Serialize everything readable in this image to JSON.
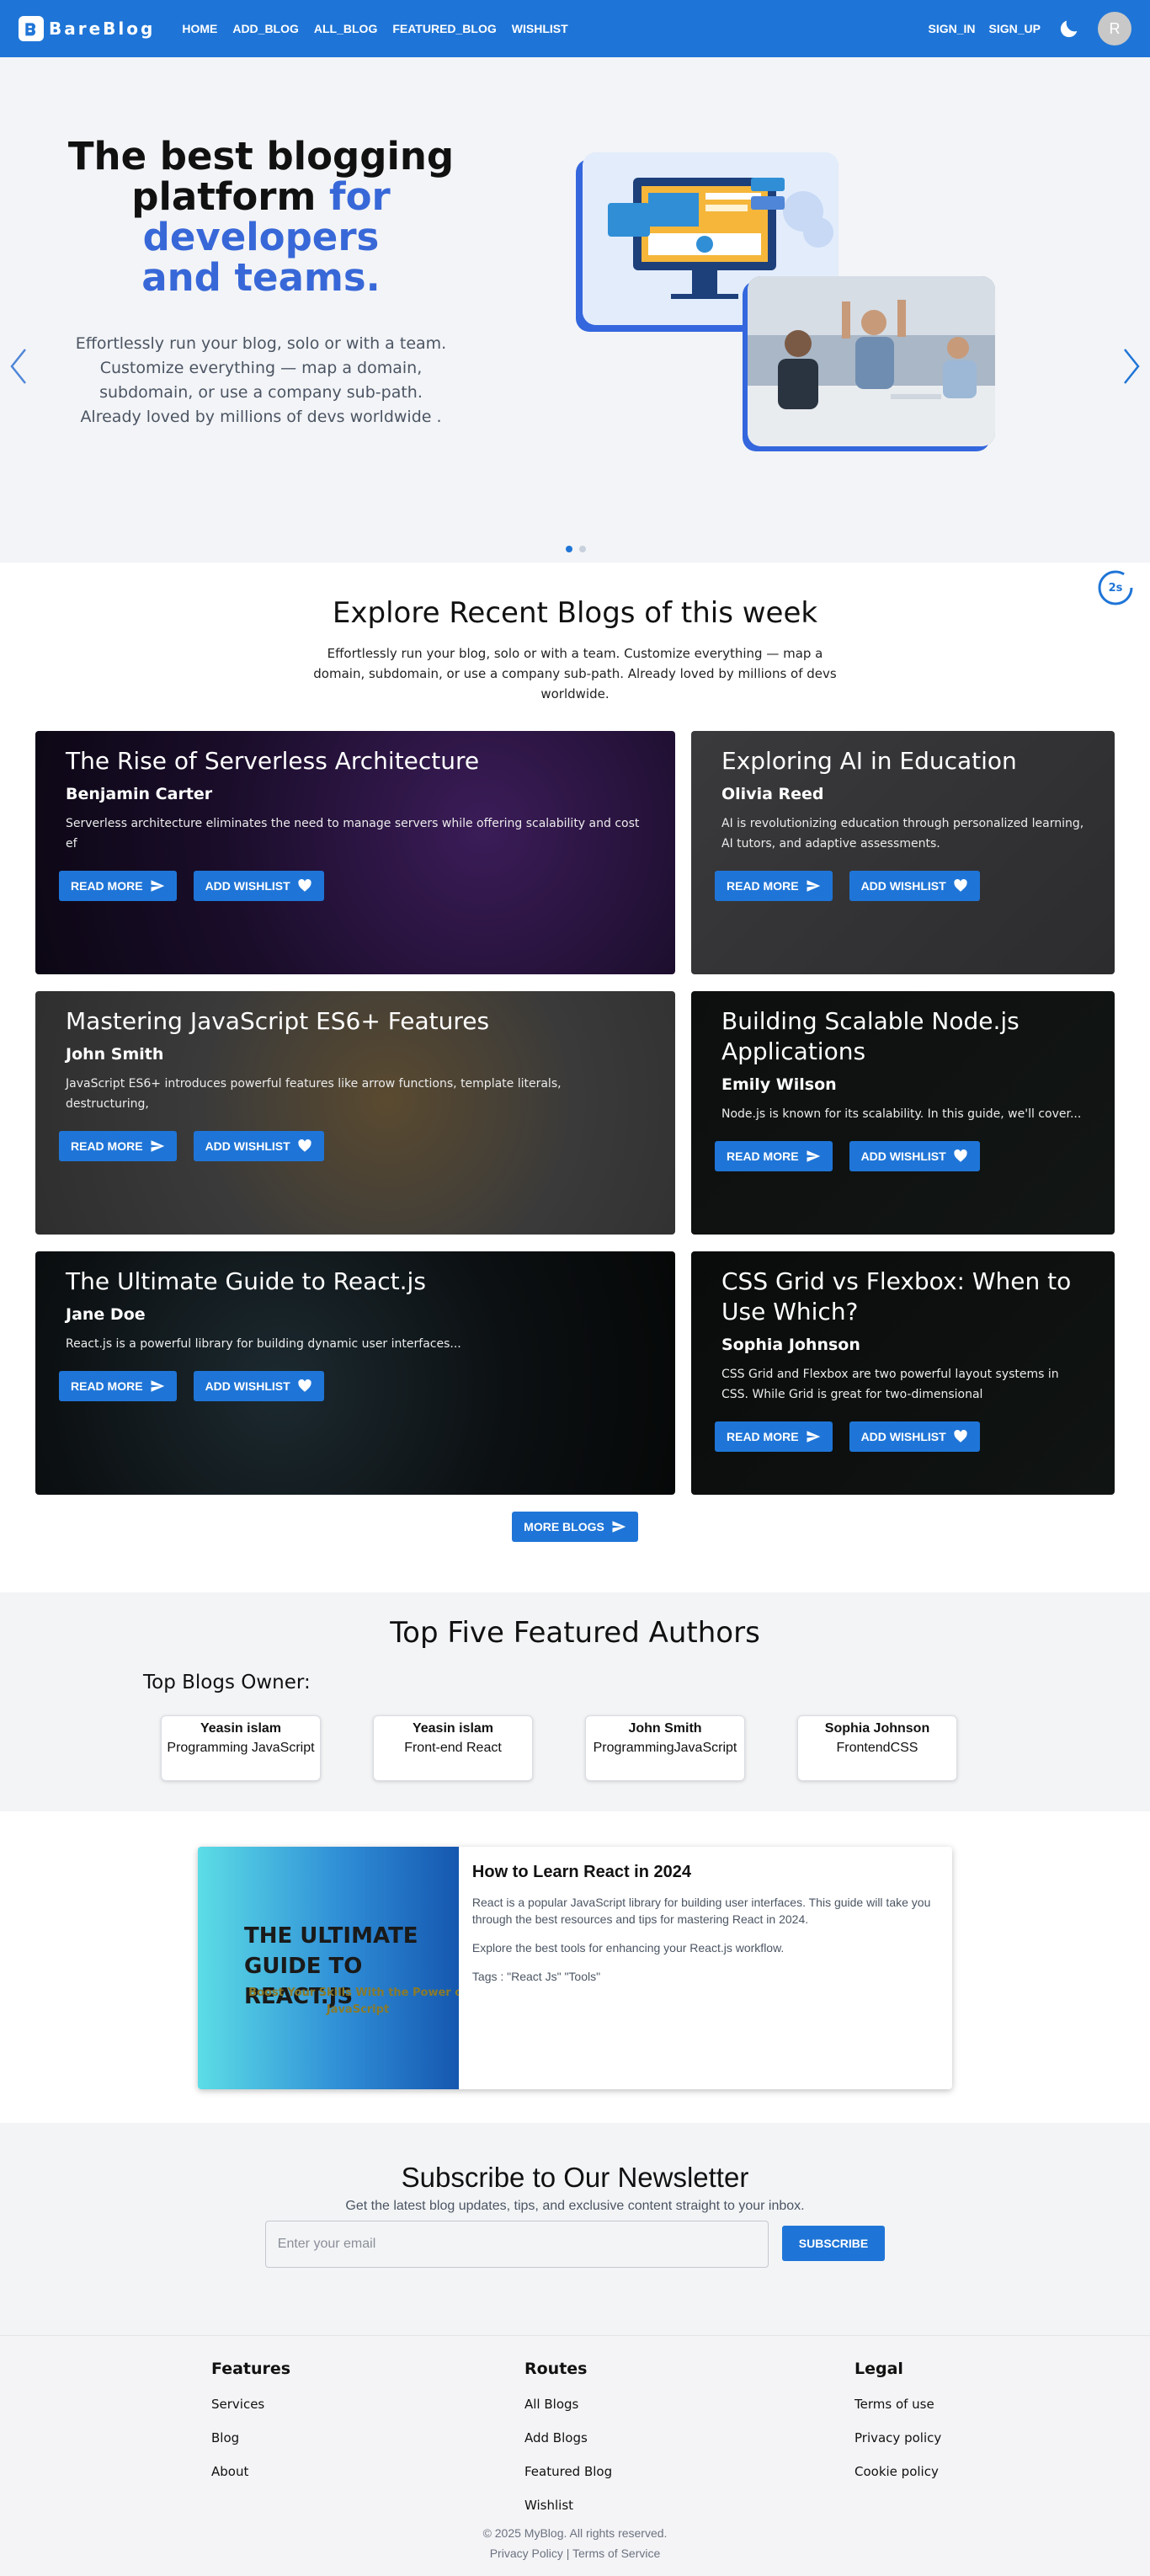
{
  "nav": {
    "brand": "BareBlog",
    "links": [
      "HOME",
      "ADD_BLOG",
      "ALL_BLOG",
      "FEATURED_BLOG",
      "WISHLIST"
    ],
    "sign_in": "SIGN_IN",
    "sign_up": "SIGN_UP",
    "avatar_initial": "R"
  },
  "hero": {
    "title_line1": "The best blogging",
    "title_line2_plain": "platform ",
    "title_line2_accent": "for developers",
    "title_line3_accent": "and teams.",
    "description": "Effortlessly run your blog, solo or with a team. Customize everything — map a domain, subdomain, or use a company sub-path. Already loved by millions of devs worldwide .",
    "timer": "2s",
    "slides": 2,
    "active_slide": 1
  },
  "recent": {
    "title": "Explore Recent Blogs of this week",
    "subtitle": "Effortlessly run your blog, solo or with a team. Customize everything — map a domain, subdomain, or use a company sub-path. Already loved by millions of devs worldwide.",
    "read_more": "READ MORE",
    "add_wishlist": "ADD WISHLIST",
    "more_blogs": "MORE BLOGS",
    "blogs": [
      {
        "title": "The Rise of Serverless Architecture",
        "author": "Benjamin Carter",
        "desc": "Serverless architecture eliminates the need to manage servers while offering scalability and cost ef"
      },
      {
        "title": "Exploring AI in Education",
        "author": "Olivia Reed",
        "desc": "AI is revolutionizing education through personalized learning, AI tutors, and adaptive assessments."
      },
      {
        "title": "Mastering JavaScript ES6+ Features",
        "author": "John Smith",
        "desc": "JavaScript ES6+ introduces powerful features like arrow functions, template literals, destructuring,"
      },
      {
        "title": "Building Scalable Node.js Applications",
        "author": "Emily Wilson",
        "desc": "Node.js is known for its scalability. In this guide, we'll cover..."
      },
      {
        "title": "The Ultimate Guide to React.js",
        "author": "Jane Doe",
        "desc": "React.js is a powerful library for building dynamic user interfaces..."
      },
      {
        "title": "CSS Grid vs Flexbox: When to Use Which?",
        "author": "Sophia Johnson",
        "desc": "CSS Grid and Flexbox are two powerful layout systems in CSS. While Grid is great for two-dimensional"
      }
    ]
  },
  "authors": {
    "title": "Top Five Featured Authors",
    "subtitle": "Top Blogs Owner:",
    "items": [
      {
        "name": "Yeasin islam",
        "topic": "Programming JavaScript"
      },
      {
        "name": "Yeasin islam",
        "topic": "Front-end React"
      },
      {
        "name": "John Smith",
        "topic": "ProgrammingJavaScript"
      },
      {
        "name": "Sophia Johnson",
        "topic": "FrontendCSS"
      }
    ]
  },
  "feature": {
    "image_title_line1": "THE ULTIMATE",
    "image_title_line2": "GUIDE TO REACT.JS",
    "image_tagline": "Boost Your Skills With the Power of JavaScript",
    "title": "How to Learn React in 2024",
    "para1": "React is a popular JavaScript library for building user interfaces. This guide will take you through the best resources and tips for mastering React in 2024.",
    "para2": "Explore the best tools for enhancing your React.js workflow.",
    "tags": "Tags : \"React Js\" \"Tools\""
  },
  "newsletter": {
    "title": "Subscribe to Our Newsletter",
    "subtitle": "Get the latest blog updates, tips, and exclusive content straight to your inbox.",
    "placeholder": "Enter your email",
    "button": "SUBSCRIBE"
  },
  "footer": {
    "features": {
      "heading": "Features",
      "links": [
        "Services",
        "Blog",
        "About"
      ]
    },
    "routes": {
      "heading": "Routes",
      "links": [
        "All Blogs",
        "Add Blogs",
        "Featured Blog",
        "Wishlist"
      ]
    },
    "legal": {
      "heading": "Legal",
      "links": [
        "Terms of use",
        "Privacy policy",
        "Cookie policy"
      ]
    },
    "copyright": "© 2025 MyBlog. All rights reserved.",
    "policy_links": "Privacy Policy | Terms of Service"
  },
  "colors": {
    "primary": "#1f75d7",
    "accent": "#3868d8",
    "page_bg": "#f3f4f6"
  }
}
